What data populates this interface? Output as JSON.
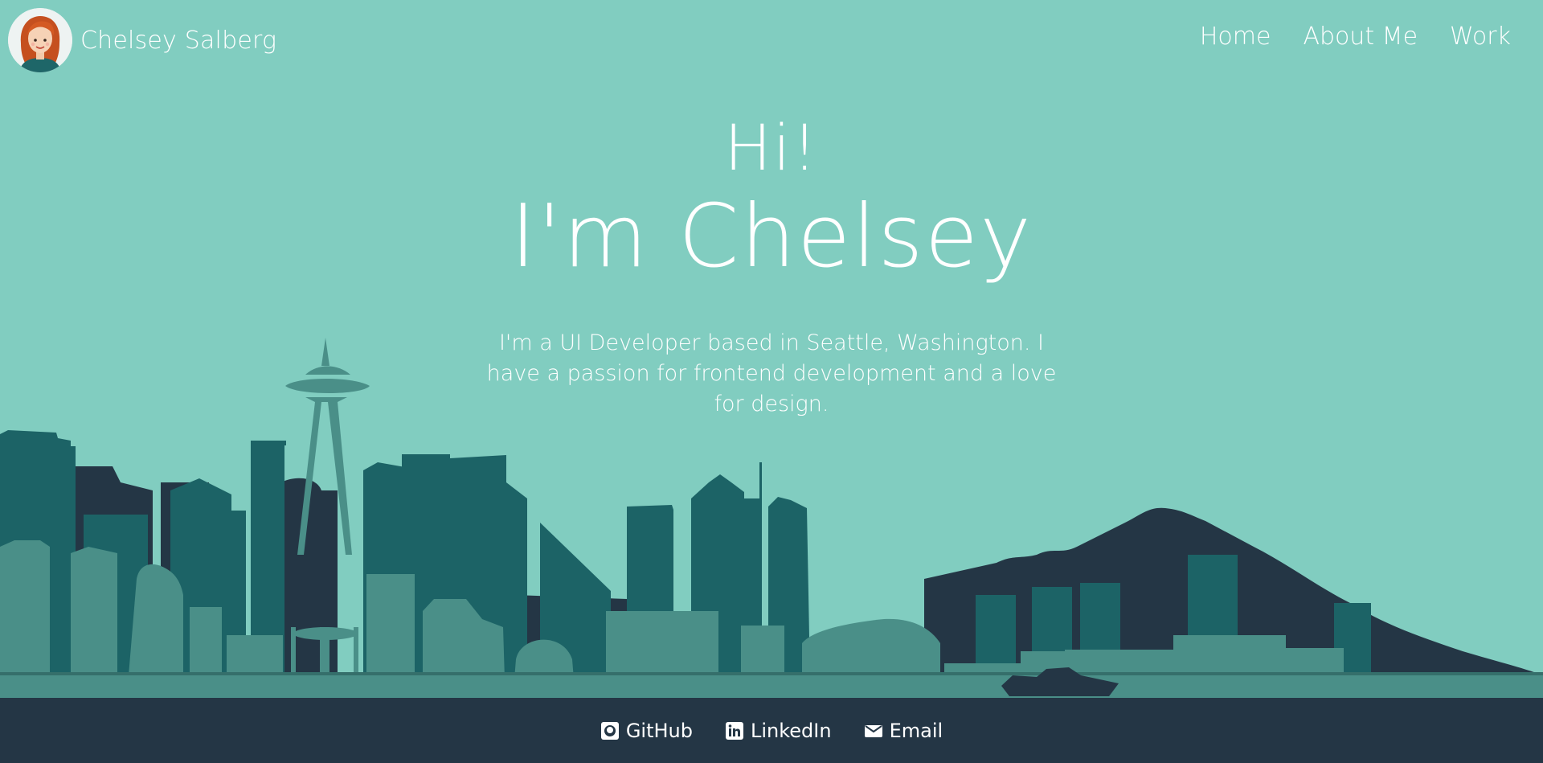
{
  "header": {
    "brand_name": "Chelsey Salberg",
    "nav": [
      {
        "label": "Home"
      },
      {
        "label": "About Me"
      },
      {
        "label": "Work"
      }
    ]
  },
  "hero": {
    "greeting": "Hi!",
    "name": "I'm Chelsey",
    "bio": "I'm a UI Developer based in Seattle, Washington. I have a passion for frontend development and a love for design."
  },
  "footer": {
    "links": [
      {
        "label": "GitHub",
        "icon": "github-icon"
      },
      {
        "label": "LinkedIn",
        "icon": "linkedin-icon"
      },
      {
        "label": "Email",
        "icon": "envelope-icon"
      }
    ]
  },
  "colors": {
    "background": "#81cdc0",
    "skyline_dark": "#1c6366",
    "skyline_light": "#4a8f88",
    "mountain": "#243645",
    "footer": "#243645"
  }
}
